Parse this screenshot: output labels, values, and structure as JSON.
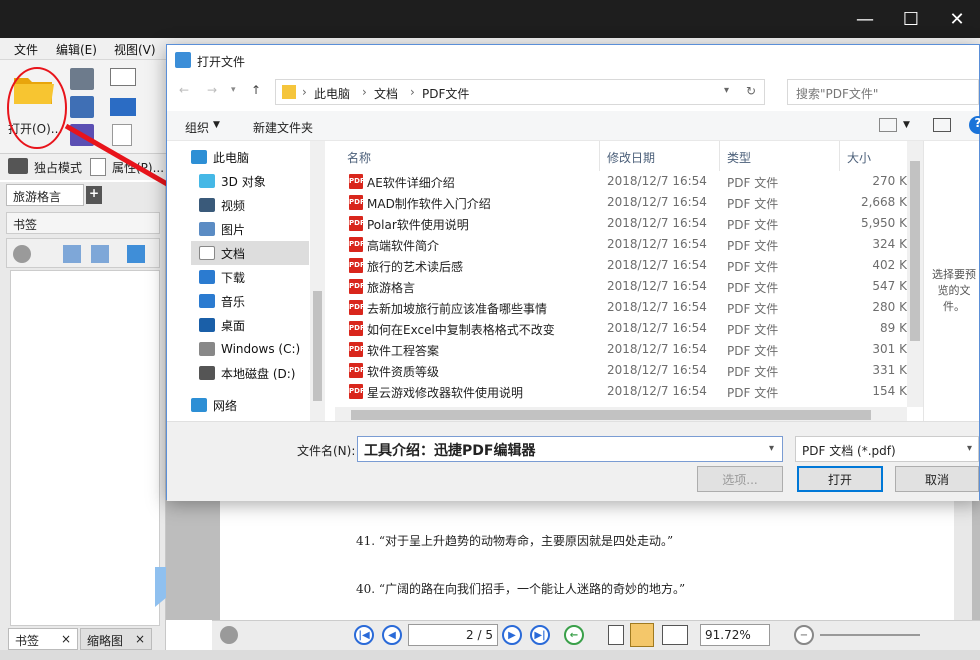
{
  "app": {
    "menu": [
      "文件",
      "编辑(E)",
      "视图(V)"
    ],
    "toolbar": {
      "open_label": "打开(O)...",
      "exclusive_mode": "独占模式",
      "properties": "属性(P)..."
    },
    "left_tabs": {
      "doc_tab": "旅游格言",
      "bookmarks_header": "书签",
      "bottom_tab1": "书签",
      "bottom_tab2": "缩略图"
    },
    "doc_lines": [
      "41. “对于呈上升趋势的动物寿命，主要原因就是四处走动。”",
      "40. “广阔的路在向我们招手，一个能让人迷路的奇妙的地方。”"
    ],
    "page_indicator": "2 / 5",
    "zoom": "91.72%"
  },
  "dialog": {
    "title": "打开文件",
    "breadcrumb": [
      "此电脑",
      "文档",
      "PDF文件"
    ],
    "search_placeholder": "搜索\"PDF文件\"",
    "organize": "组织",
    "new_folder": "新建文件夹",
    "nav": [
      {
        "label": "此电脑",
        "icon": "computer-icon"
      },
      {
        "label": "3D 对象",
        "icon": "cube-icon"
      },
      {
        "label": "视频",
        "icon": "video-icon"
      },
      {
        "label": "图片",
        "icon": "picture-icon"
      },
      {
        "label": "文档",
        "icon": "document-icon"
      },
      {
        "label": "下载",
        "icon": "download-icon"
      },
      {
        "label": "音乐",
        "icon": "music-icon"
      },
      {
        "label": "桌面",
        "icon": "desktop-icon"
      },
      {
        "label": "Windows (C:)",
        "icon": "drive-windows-icon"
      },
      {
        "label": "本地磁盘 (D:)",
        "icon": "drive-icon"
      },
      {
        "label": "网络",
        "icon": "network-icon"
      }
    ],
    "columns": {
      "name": "名称",
      "date": "修改日期",
      "type": "类型",
      "size": "大小"
    },
    "files": [
      {
        "name": "AE软件详细介绍",
        "date": "2018/12/7 16:54",
        "type": "PDF 文件",
        "size": "270 K"
      },
      {
        "name": "MAD制作软件入门介绍",
        "date": "2018/12/7 16:54",
        "type": "PDF 文件",
        "size": "2,668 K"
      },
      {
        "name": "Polar软件使用说明",
        "date": "2018/12/7 16:54",
        "type": "PDF 文件",
        "size": "5,950 K"
      },
      {
        "name": "高端软件简介",
        "date": "2018/12/7 16:54",
        "type": "PDF 文件",
        "size": "324 K"
      },
      {
        "name": "旅行的艺术读后感",
        "date": "2018/12/7 16:54",
        "type": "PDF 文件",
        "size": "402 K"
      },
      {
        "name": "旅游格言",
        "date": "2018/12/7 16:54",
        "type": "PDF 文件",
        "size": "547 K"
      },
      {
        "name": "去新加坡旅行前应该准备哪些事情",
        "date": "2018/12/7 16:54",
        "type": "PDF 文件",
        "size": "280 K"
      },
      {
        "name": "如何在Excel中复制表格格式不改变",
        "date": "2018/12/7 16:54",
        "type": "PDF 文件",
        "size": "89 K"
      },
      {
        "name": "软件工程答案",
        "date": "2018/12/7 16:54",
        "type": "PDF 文件",
        "size": "301 K"
      },
      {
        "name": "软件资质等级",
        "date": "2018/12/7 16:54",
        "type": "PDF 文件",
        "size": "331 K"
      },
      {
        "name": "星云游戏修改器软件使用说明",
        "date": "2018/12/7 16:54",
        "type": "PDF 文件",
        "size": "154 K"
      }
    ],
    "preview_text": "选择要预览的文件。",
    "filename_label": "文件名(N):",
    "filename_value": "工具介绍：迅捷PDF编辑器",
    "filetype": "PDF 文档 (*.pdf)",
    "options_button": "选项...",
    "open_button": "打开",
    "cancel_button": "取消"
  }
}
